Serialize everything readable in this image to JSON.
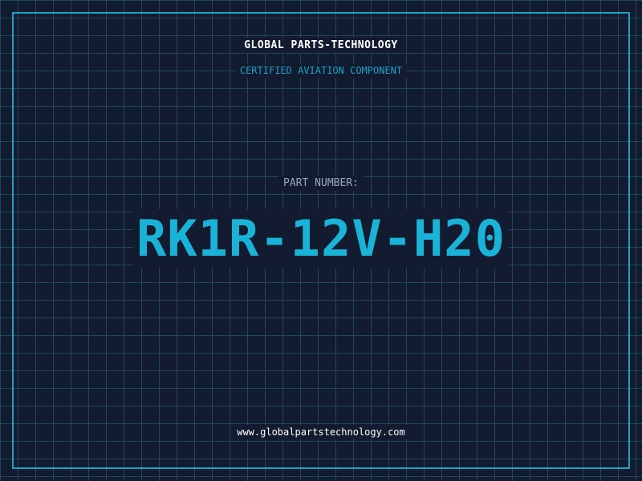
{
  "header": {
    "company_name": "GLOBAL PARTS-TECHNOLOGY",
    "subtitle": "CERTIFIED AVIATION COMPONENT"
  },
  "part": {
    "label": "PART NUMBER:",
    "number": "RK1R-12V-H20"
  },
  "footer": {
    "website": "www.globalpartstechnology.com"
  },
  "colors": {
    "background": "#121b2f",
    "grid_line": "#1e4a5e",
    "accent": "#1da2c7",
    "part_number": "#1ab3d8",
    "text_primary": "#ffffff",
    "text_muted": "#9aa6b8"
  }
}
